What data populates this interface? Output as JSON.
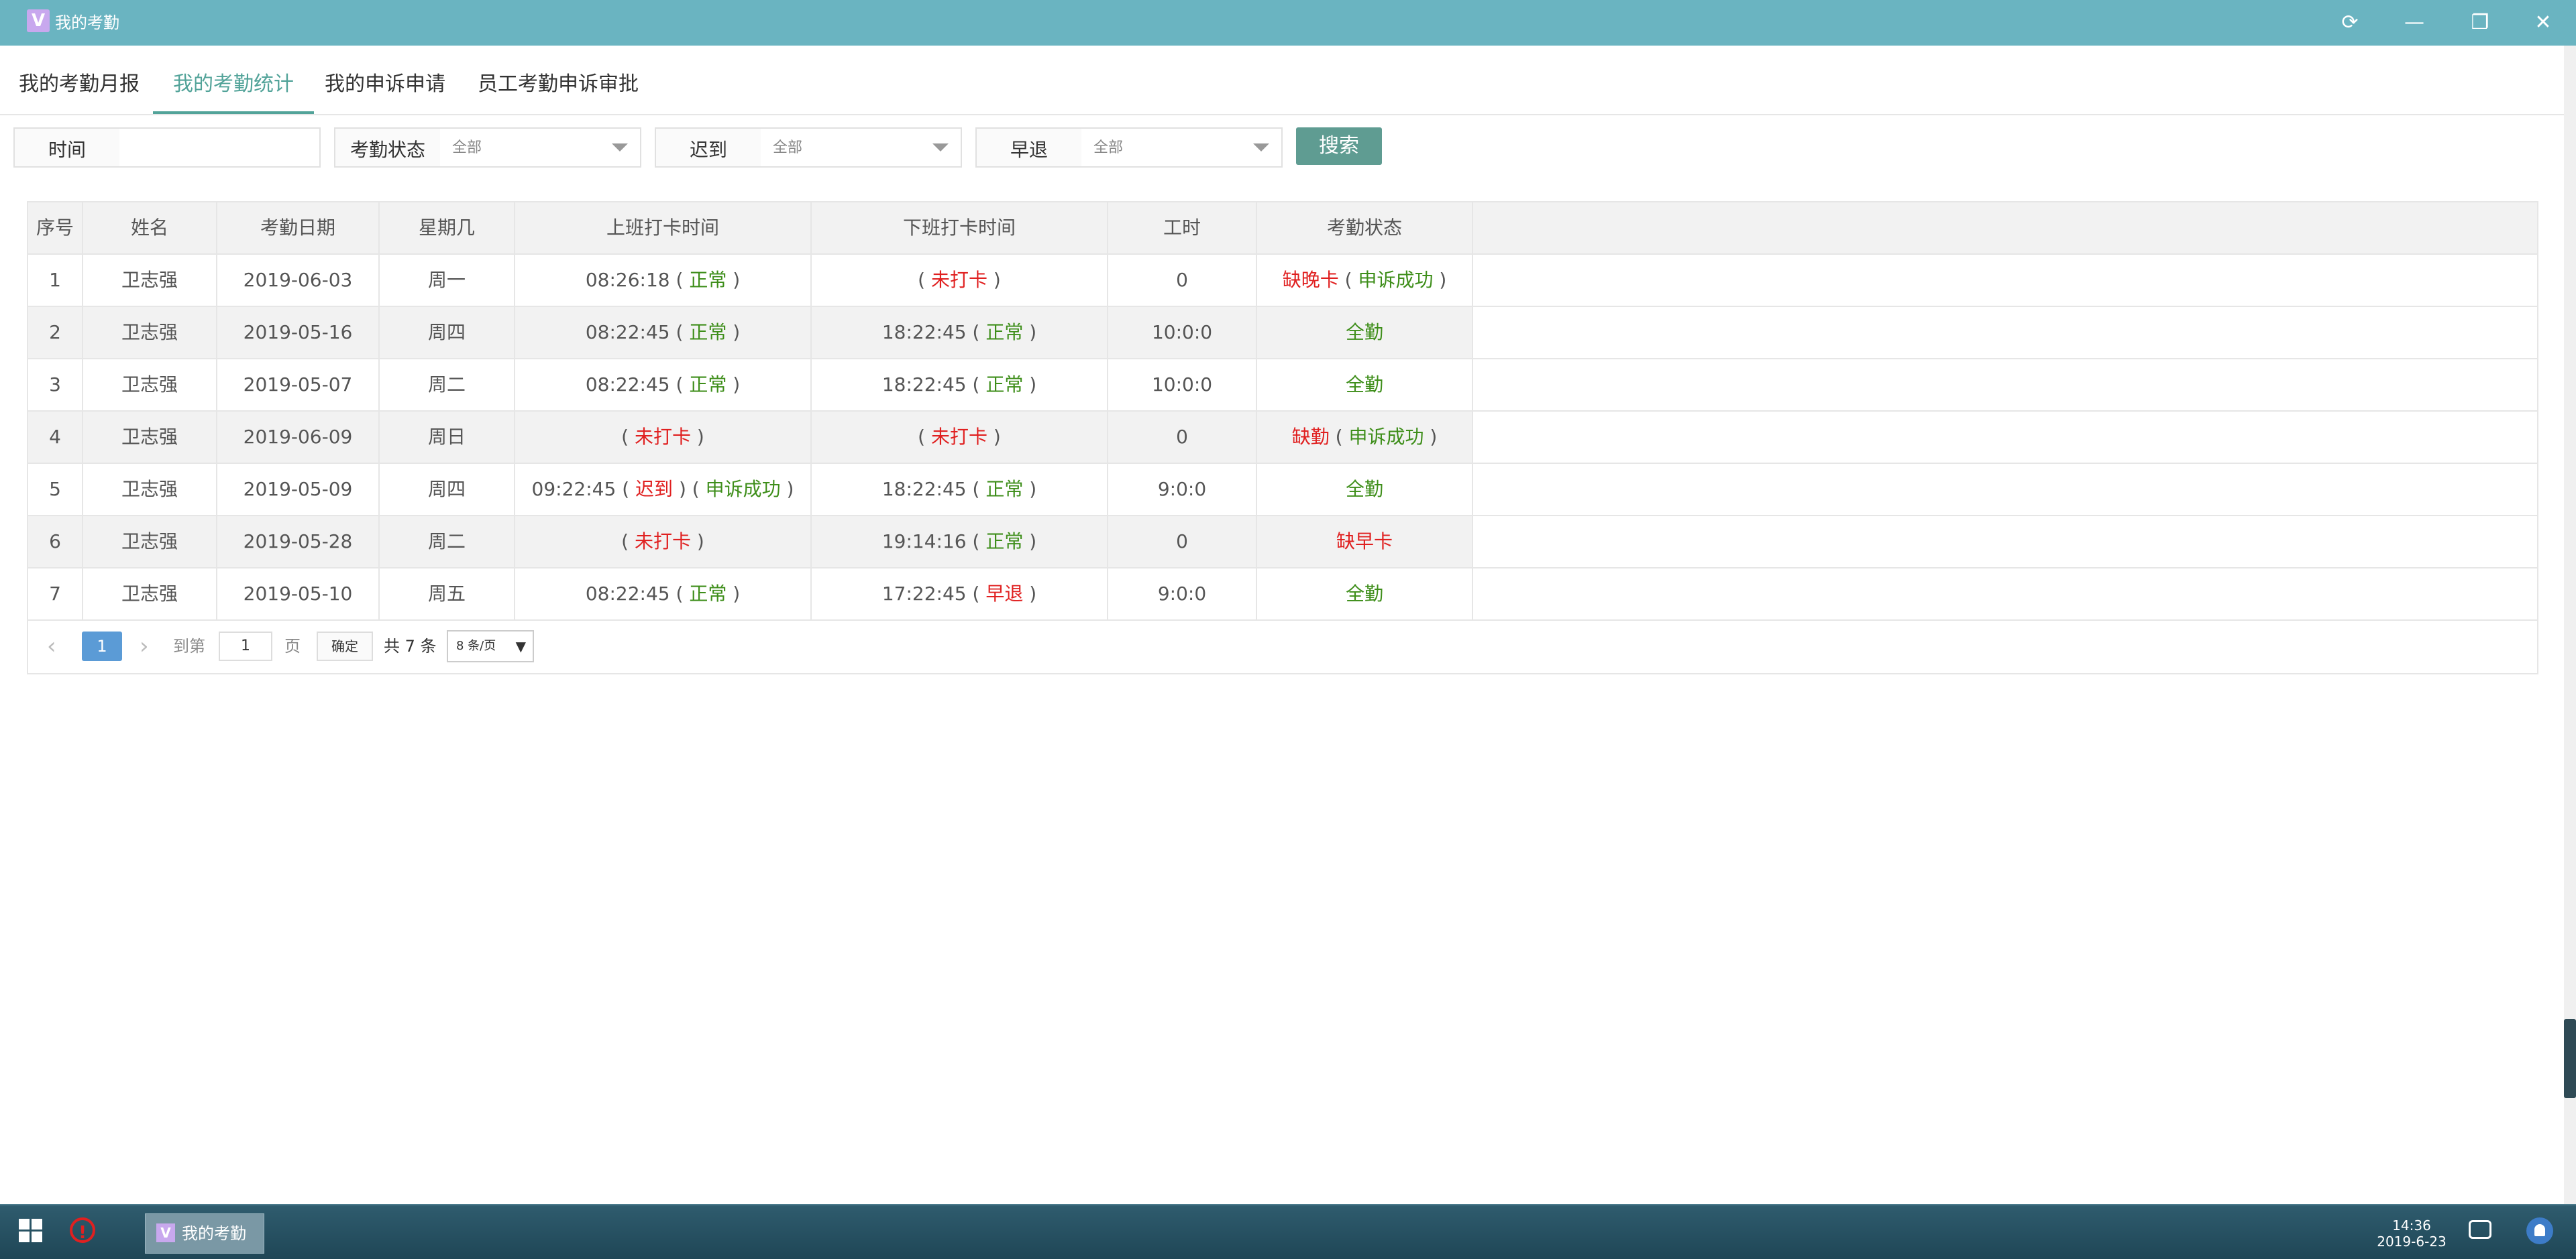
{
  "window": {
    "title": "我的考勤",
    "app_icon_letter": "V",
    "controls": {
      "refresh": "⟳",
      "minimize": "—",
      "restore": "❐",
      "close": "✕"
    }
  },
  "tabs": [
    {
      "label": "我的考勤月报",
      "active": false
    },
    {
      "label": "我的考勤统计",
      "active": true
    },
    {
      "label": "我的申诉申请",
      "active": false
    },
    {
      "label": "员工考勤申诉审批",
      "active": false
    }
  ],
  "filters": {
    "time_label": "时间",
    "time_value": "",
    "status_label": "考勤状态",
    "status_value": "全部",
    "late_label": "迟到",
    "late_value": "全部",
    "early_label": "早退",
    "early_value": "全部",
    "search_label": "搜索"
  },
  "table": {
    "headers": [
      "序号",
      "姓名",
      "考勤日期",
      "星期几",
      "上班打卡时间",
      "下班打卡时间",
      "工时",
      "考勤状态"
    ],
    "rows": [
      {
        "no": "1",
        "name": "卫志强",
        "date": "2019-06-03",
        "weekday": "周一",
        "on_time": "08:26:18",
        "on_status": "正常",
        "on_extra": "",
        "off_time": "",
        "off_status": "未打卡",
        "hours": "0",
        "att_status": "缺晚卡",
        "att_extra": "申诉成功"
      },
      {
        "no": "2",
        "name": "卫志强",
        "date": "2019-05-16",
        "weekday": "周四",
        "on_time": "08:22:45",
        "on_status": "正常",
        "on_extra": "",
        "off_time": "18:22:45",
        "off_status": "正常",
        "hours": "10:0:0",
        "att_status": "全勤",
        "att_extra": ""
      },
      {
        "no": "3",
        "name": "卫志强",
        "date": "2019-05-07",
        "weekday": "周二",
        "on_time": "08:22:45",
        "on_status": "正常",
        "on_extra": "",
        "off_time": "18:22:45",
        "off_status": "正常",
        "hours": "10:0:0",
        "att_status": "全勤",
        "att_extra": ""
      },
      {
        "no": "4",
        "name": "卫志强",
        "date": "2019-06-09",
        "weekday": "周日",
        "on_time": "",
        "on_status": "未打卡",
        "on_extra": "",
        "off_time": "",
        "off_status": "未打卡",
        "hours": "0",
        "att_status": "缺勤",
        "att_extra": "申诉成功"
      },
      {
        "no": "5",
        "name": "卫志强",
        "date": "2019-05-09",
        "weekday": "周四",
        "on_time": "09:22:45",
        "on_status": "迟到",
        "on_extra": "申诉成功",
        "off_time": "18:22:45",
        "off_status": "正常",
        "hours": "9:0:0",
        "att_status": "全勤",
        "att_extra": ""
      },
      {
        "no": "6",
        "name": "卫志强",
        "date": "2019-05-28",
        "weekday": "周二",
        "on_time": "",
        "on_status": "未打卡",
        "on_extra": "",
        "off_time": "19:14:16",
        "off_status": "正常",
        "hours": "0",
        "att_status": "缺早卡",
        "att_extra": ""
      },
      {
        "no": "7",
        "name": "卫志强",
        "date": "2019-05-10",
        "weekday": "周五",
        "on_time": "08:22:45",
        "on_status": "正常",
        "on_extra": "",
        "off_time": "17:22:45",
        "off_status": "早退",
        "hours": "9:0:0",
        "att_status": "全勤",
        "att_extra": ""
      }
    ]
  },
  "pagination": {
    "prev": "‹",
    "current_page": "1",
    "next": "›",
    "goto_label": "到第",
    "goto_value": "1",
    "page_unit": "页",
    "confirm_label": "确定",
    "total_label": "共 7 条",
    "page_size_label": "8 条/页",
    "page_size_arrow": "▼"
  },
  "taskbar": {
    "app_label": "我的考勤",
    "app_icon_letter": "V",
    "alert_glyph": "!",
    "clock_time": "14:36",
    "clock_date": "2019-6-23"
  },
  "colors": {
    "titlebar": "#6ab4c1",
    "tab_active": "#52a399",
    "search_button": "#5f9c92",
    "status_ok": "#3e8e1a",
    "status_bad": "#e02020",
    "page_active": "#5b9bd6"
  }
}
